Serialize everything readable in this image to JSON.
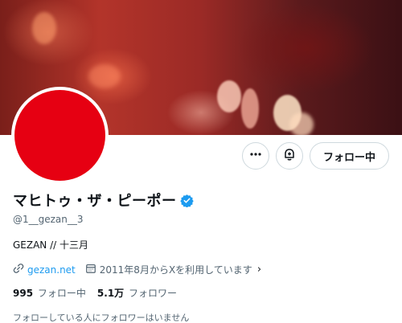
{
  "profile": {
    "display_name": "マヒトゥ・ザ・ピーポー",
    "handle": "@1__gezan__3",
    "bio": "GEZAN // 十三月",
    "verified": true,
    "avatar_color": "#e60012"
  },
  "actions": {
    "more_icon": "more-horizontal-icon",
    "notify_icon": "bell-plus-icon",
    "follow_label": "フォロー中"
  },
  "meta": {
    "link_icon": "link-icon",
    "link_text": "gezan.net",
    "joined_icon": "calendar-icon",
    "joined_text": "2011年8月からXを利用しています",
    "joined_chevron": "›"
  },
  "stats": {
    "following_count": "995",
    "following_label": "フォロー中",
    "followers_count": "5.1万",
    "followers_label": "フォロワー"
  },
  "followers_you_know": "フォローしている人にフォロワーはいません",
  "colors": {
    "accent": "#1d9bf0",
    "text": "#0f1419",
    "secondary": "#536471"
  }
}
